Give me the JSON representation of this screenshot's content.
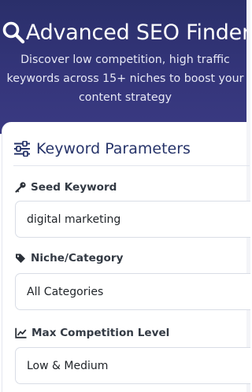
{
  "hero": {
    "title": "Advanced SEO Finder",
    "subtitle_lines": [
      "Discover low competition, high traffic",
      "keywords across 15+ niches to boost your",
      "content strategy"
    ],
    "icon": "search-icon"
  },
  "params": {
    "title": "Keyword Parameters",
    "icon": "sliders-icon",
    "fields": [
      {
        "label": "Seed Keyword",
        "icon": "key-icon",
        "value": "digital marketing"
      },
      {
        "label": "Niche/Category",
        "icon": "tag-icon",
        "value": "All Categories"
      },
      {
        "label": "Max Competition Level",
        "icon": "chart-line-icon",
        "value": "Low & Medium"
      }
    ]
  },
  "colors": {
    "hero_bg": "#2f3372",
    "heading": "#27346a",
    "label": "#333a44"
  }
}
